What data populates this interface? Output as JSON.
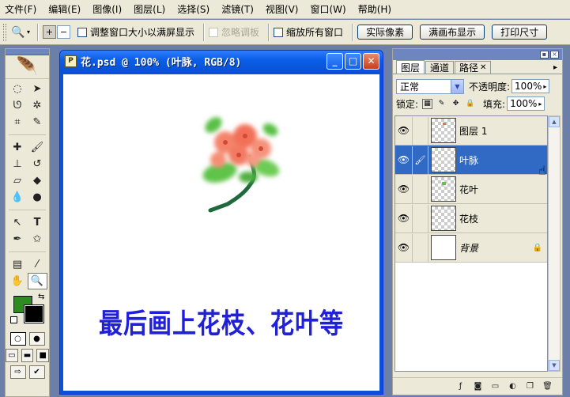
{
  "menu": [
    "文件(F)",
    "编辑(E)",
    "图像(I)",
    "图层(L)",
    "选择(S)",
    "滤镜(T)",
    "视图(V)",
    "窗口(W)",
    "帮助(H)"
  ],
  "options": {
    "adjust_window": "调整窗口大小以满屏显示",
    "ignore_palettes": "忽略调板",
    "zoom_all": "缩放所有窗口",
    "actual_pixels": "实际像素",
    "fit_screen": "满画布显示",
    "print_size": "打印尺寸"
  },
  "document": {
    "title": "花.psd @ 100% (叶脉, RGB/8)",
    "caption": "最后画上花枝、花叶等"
  },
  "colors": {
    "foreground": "#2e8b20",
    "background": "#000000",
    "caption": "#2020d8",
    "selection": "#316ac5"
  },
  "layers_panel": {
    "tabs": [
      "图层",
      "通道",
      "路径"
    ],
    "blend_mode": "正常",
    "opacity_label": "不透明度:",
    "opacity": "100%",
    "lock_label": "锁定:",
    "fill_label": "填充:",
    "fill": "100%",
    "layers": [
      {
        "name": "图层 1",
        "active": false
      },
      {
        "name": "叶脉",
        "active": true
      },
      {
        "name": "花叶",
        "active": false
      },
      {
        "name": "花枝",
        "active": false
      },
      {
        "name": "背景",
        "active": false,
        "locked": true
      }
    ]
  }
}
